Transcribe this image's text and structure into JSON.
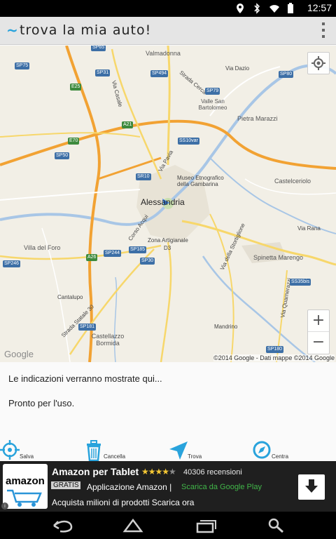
{
  "status_bar": {
    "time": "12:57"
  },
  "action_bar": {
    "app_icon": "~",
    "title": "trova la mia auto!"
  },
  "map": {
    "labels": {
      "valmadonna": "Valmadonna",
      "via_dazio": "Via Dazio",
      "strada_cerca": "Strada Cerca",
      "valle_san_bartolomeo": "Valle San Bartolomeo",
      "pietra_marazzi": "Pietra Marazzi",
      "via_casale": "Via Casale",
      "via_pavia": "Via Pavia",
      "museo": "Museo Etnografico della Gambarina",
      "alessandria": "Alessandria",
      "castelceriolo": "Castelceriolo",
      "corso_acqui": "Corso Acqui",
      "zona_artigianale": "Zona Artigianale",
      "d3": "D3",
      "via_rana": "Via Rana",
      "villa_del_foro": "Villa del Foro",
      "via_stortiglione": "Via della Stortiglione",
      "spinetta_marengo": "Spinetta Marengo",
      "cantalupo": "Cantalupo",
      "via_quarnerazzi": "Via Quarnerazzi",
      "strada_statale_30": "Strada Statale 30",
      "castellazzo_bormida": "Castellazzo Bormida",
      "mandrino": "Mandrino"
    },
    "shields": {
      "sp65": "SP65",
      "sp75": "SP75",
      "sp31": "SP31",
      "sp494": "SP494",
      "sp79": "SP79",
      "sp80": "SP80",
      "e25": "E25",
      "a21": "A21",
      "e70": "E70",
      "ss10var": "SS10var",
      "sp50": "SP50",
      "sr10": "SR10",
      "sp244": "SP244",
      "sp185": "SP185",
      "a26": "A26",
      "sp246": "SP246",
      "sp30": "SP30",
      "ss35bis": "SS35bis",
      "sp181": "SP181",
      "sp180": "SP180"
    },
    "zoom_in": "+",
    "zoom_out": "−",
    "google_logo": "Google",
    "copyright": "©2014 Google - Dati mappe ©2014 Google"
  },
  "info": {
    "directions": "Le indicazioni verranno mostrate qui...",
    "status": "Pronto per l'uso."
  },
  "toolbar": {
    "salva": "Salva",
    "cancella": "Cancella",
    "trova": "Trova",
    "centra": "Centra"
  },
  "ad": {
    "logo_text": "amazon",
    "title": "Amazon per Tablet",
    "stars": "★★★★★",
    "rating": 4,
    "reviews": "40306 recensioni",
    "badge": "GRATIS",
    "app_name": "Applicazione Amazon |",
    "store": "Scarica da Google Play",
    "tagline": "Acquista milioni di prodotti Scarica ora"
  },
  "colors": {
    "action_bar_bg": "#e5e5e5",
    "accent": "#29a3dc",
    "map_bg": "#f2efe6",
    "highway": "#f2a233",
    "road": "#f7d76b",
    "water": "#a8c6e6",
    "ad_bg": "#1f1f1f"
  }
}
